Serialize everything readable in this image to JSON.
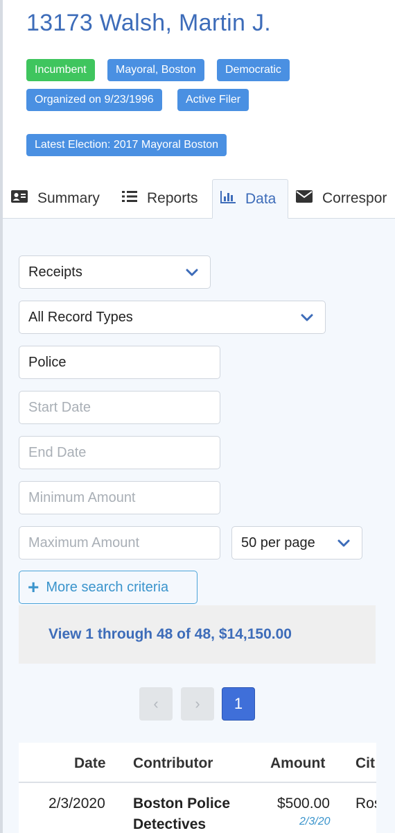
{
  "candidate": {
    "title": "13173 Walsh, Martin J."
  },
  "badges": [
    "Incumbent",
    "Mayoral, Boston",
    "Democratic",
    "Organized on 9/23/1996",
    "Active Filer",
    "Latest Election: 2017 Mayoral Boston"
  ],
  "colors": {
    "accent": "#3d6cb9",
    "badge_blue": "#4a90e2",
    "badge_green": "#3fc55e",
    "link": "#3a94cc"
  },
  "tabs": [
    {
      "label": "Summary",
      "icon": "id-card-icon"
    },
    {
      "label": "Reports",
      "icon": "list-icon"
    },
    {
      "label": "Data",
      "icon": "bar-chart-icon",
      "active": true
    },
    {
      "label": "Correspor",
      "icon": "envelope-icon"
    }
  ],
  "filters": {
    "type_select": "Receipts",
    "record_type_select": "All Record Types",
    "search_value": "Police",
    "start_date_placeholder": "Start Date",
    "end_date_placeholder": "End Date",
    "min_amount_placeholder": "Minimum Amount",
    "max_amount_placeholder": "Maximum Amount",
    "per_page_select": "50 per page",
    "more_criteria_label": "More search criteria"
  },
  "results": {
    "summary": "View 1 through 48 of 48, $14,150.00"
  },
  "pagination": {
    "prev": "‹",
    "next": "›",
    "current": "1"
  },
  "table": {
    "headers": [
      "Date",
      "Contributor",
      "Amount",
      "Cit"
    ],
    "rows": [
      {
        "date": "2/3/2020",
        "contributor_line1": "Boston Police",
        "contributor_line2": "Detectives",
        "amount": "$500.00",
        "amount_date": "2/3/20",
        "city": "Ros"
      }
    ]
  }
}
